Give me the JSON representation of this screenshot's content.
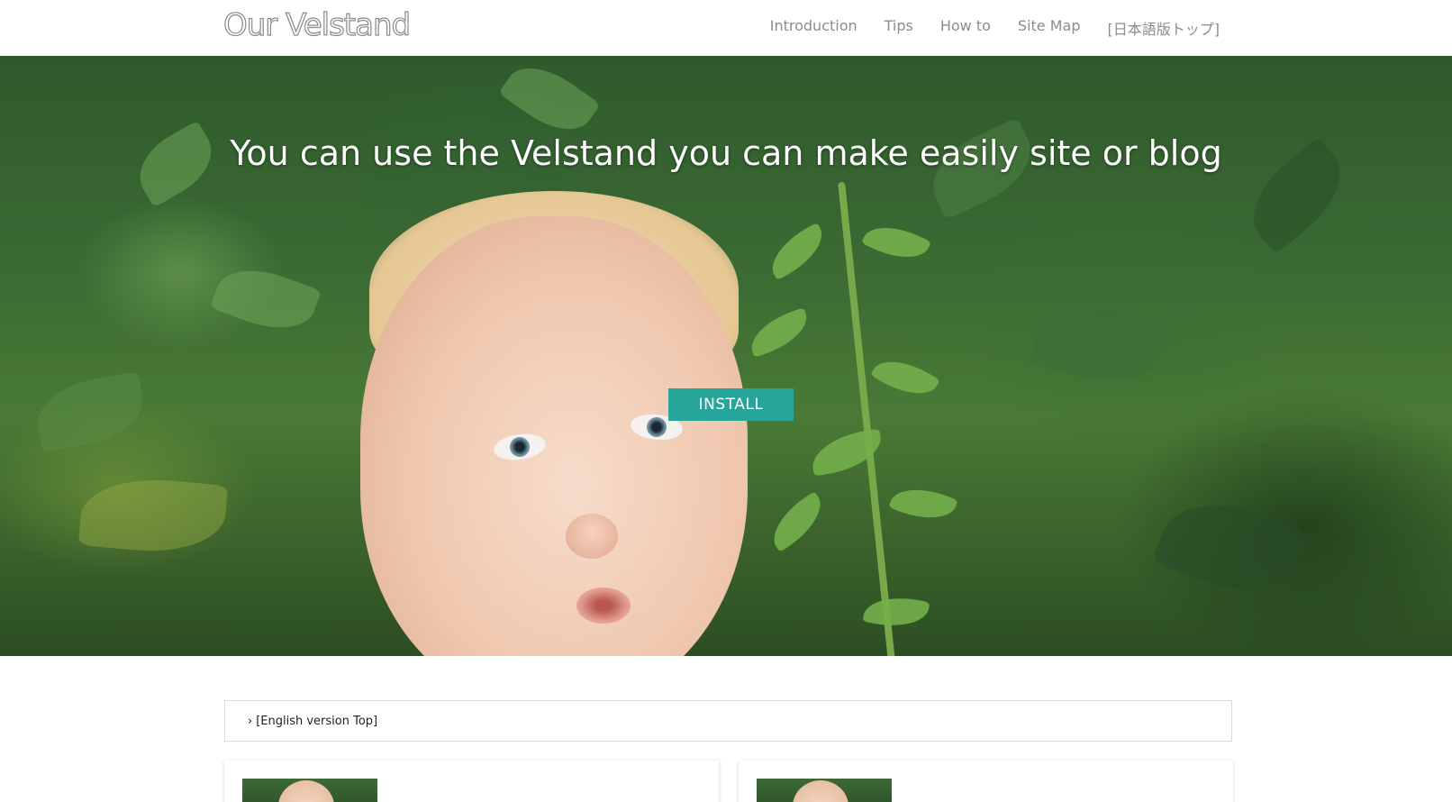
{
  "header": {
    "logo": "Our Velstand",
    "nav": [
      "Introduction",
      "Tips",
      "How to",
      "Site Map",
      "[日本語版トップ]"
    ]
  },
  "hero": {
    "title": "You can use the Velstand you can make easily site or blog",
    "button_label": "INSTALL",
    "accent_color": "#26a69a"
  },
  "breadcrumb": {
    "icon": "chevron-right-icon",
    "label": "[English version Top]"
  },
  "cards": [
    {
      "thumbnail": "baby-photo-thumbnail"
    },
    {
      "thumbnail": "baby-photo-thumbnail"
    }
  ]
}
